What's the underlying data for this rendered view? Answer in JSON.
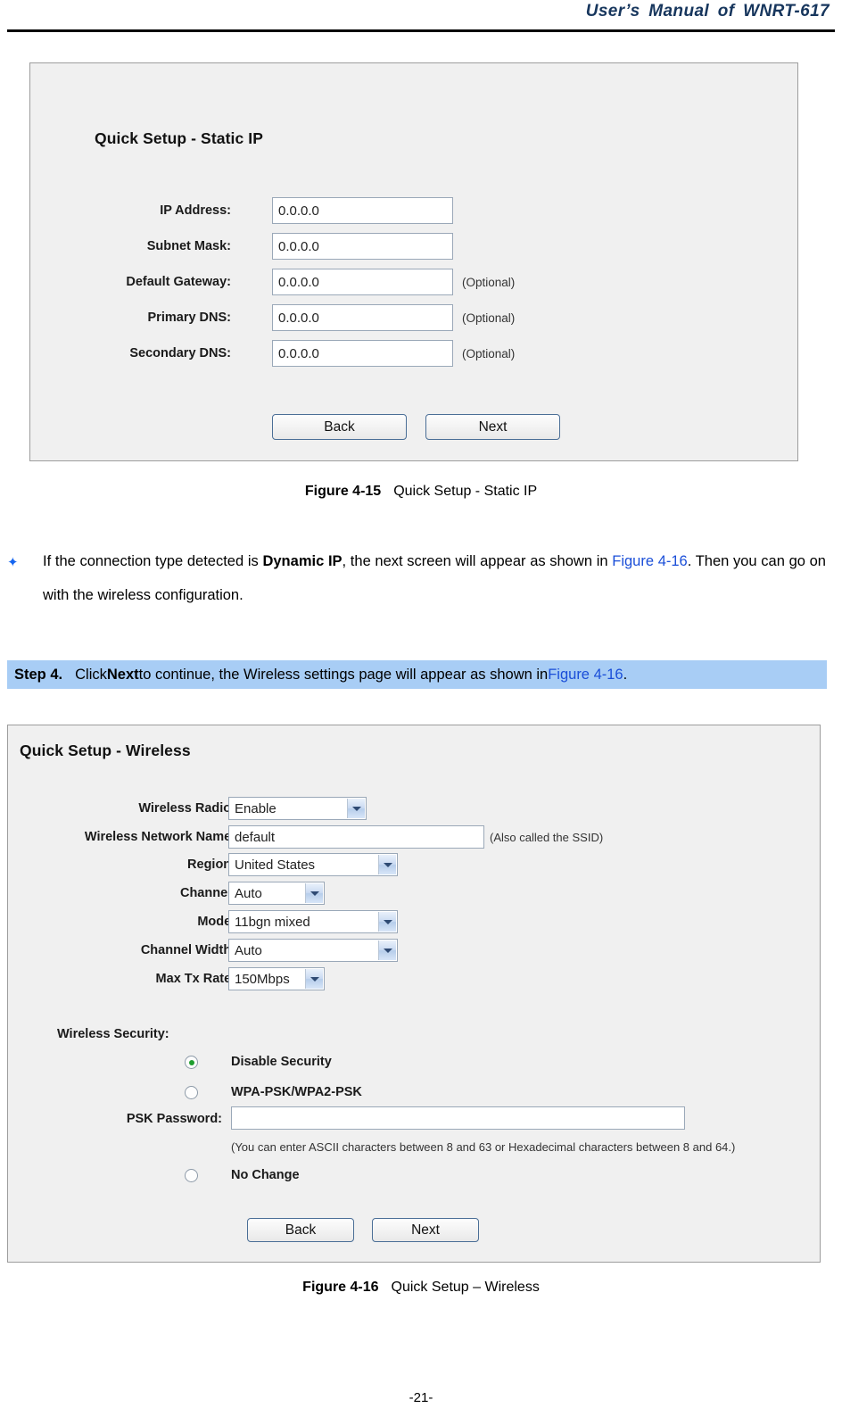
{
  "header": {
    "title": "User’s Manual of WNRT-617"
  },
  "static_ip_panel": {
    "title": "Quick Setup - Static IP",
    "fields": [
      {
        "label": "IP Address:",
        "value": "0.0.0.0",
        "note": ""
      },
      {
        "label": "Subnet Mask:",
        "value": "0.0.0.0",
        "note": ""
      },
      {
        "label": "Default Gateway:",
        "value": "0.0.0.0",
        "note": "(Optional)"
      },
      {
        "label": "Primary DNS:",
        "value": "0.0.0.0",
        "note": "(Optional)"
      },
      {
        "label": "Secondary DNS:",
        "value": "0.0.0.0",
        "note": "(Optional)"
      }
    ],
    "buttons": {
      "back": "Back",
      "next": "Next"
    }
  },
  "figure_4_15": {
    "number": "Figure 4-15",
    "title": "Quick Setup - Static IP"
  },
  "bullet_paragraph": {
    "bullet_icon": "diamond-bullet-icon",
    "text_1": "If the connection type detected is ",
    "bold_1": "Dynamic IP",
    "text_2": ", the next screen will appear as shown in ",
    "link_1": "Figure 4-16",
    "text_3": ". Then you can go on with the wireless configuration."
  },
  "step_band": {
    "step_number": "Step 4.",
    "text_1": "Click ",
    "bold_1": "Next",
    "text_2": " to continue, the Wireless settings page will appear as shown in ",
    "link_1": "Figure 4-16",
    "text_3": "."
  },
  "wireless_panel": {
    "title": "Quick Setup - Wireless",
    "rows": [
      {
        "label": "Wireless Radio:",
        "type": "select",
        "value": "Enable",
        "note": ""
      },
      {
        "label": "Wireless Network Name:",
        "type": "text",
        "value": "default",
        "note": "(Also called the SSID)"
      },
      {
        "label": "Region:",
        "type": "select",
        "value": "United States",
        "note": ""
      },
      {
        "label": "Channel:",
        "type": "select",
        "value": "Auto",
        "note": ""
      },
      {
        "label": "Mode:",
        "type": "select",
        "value": "11bgn mixed",
        "note": ""
      },
      {
        "label": "Channel Width:",
        "type": "select",
        "value": "Auto",
        "note": ""
      },
      {
        "label": "Max Tx Rate:",
        "type": "select",
        "value": "150Mbps",
        "note": ""
      }
    ],
    "security": {
      "label": "Wireless Security:",
      "options": [
        {
          "label": "Disable Security",
          "selected": true
        },
        {
          "label": "WPA-PSK/WPA2-PSK",
          "selected": false
        },
        {
          "label": "No Change",
          "selected": false
        }
      ],
      "psk_label": "PSK Password:",
      "psk_value": "",
      "psk_hint": "(You can enter ASCII characters between 8 and 63 or Hexadecimal characters between 8 and 64.)"
    },
    "buttons": {
      "back": "Back",
      "next": "Next"
    }
  },
  "figure_4_16": {
    "number": "Figure 4-16",
    "title": "Quick Setup – Wireless"
  },
  "footer": {
    "page_number": "-21-"
  },
  "colors": {
    "header_blue": "#17365d",
    "link_blue": "#1a4ed8",
    "band_blue": "#a8cdf5",
    "panel_bg": "#f0f0f0",
    "radio_green": "#1f9e2f"
  }
}
